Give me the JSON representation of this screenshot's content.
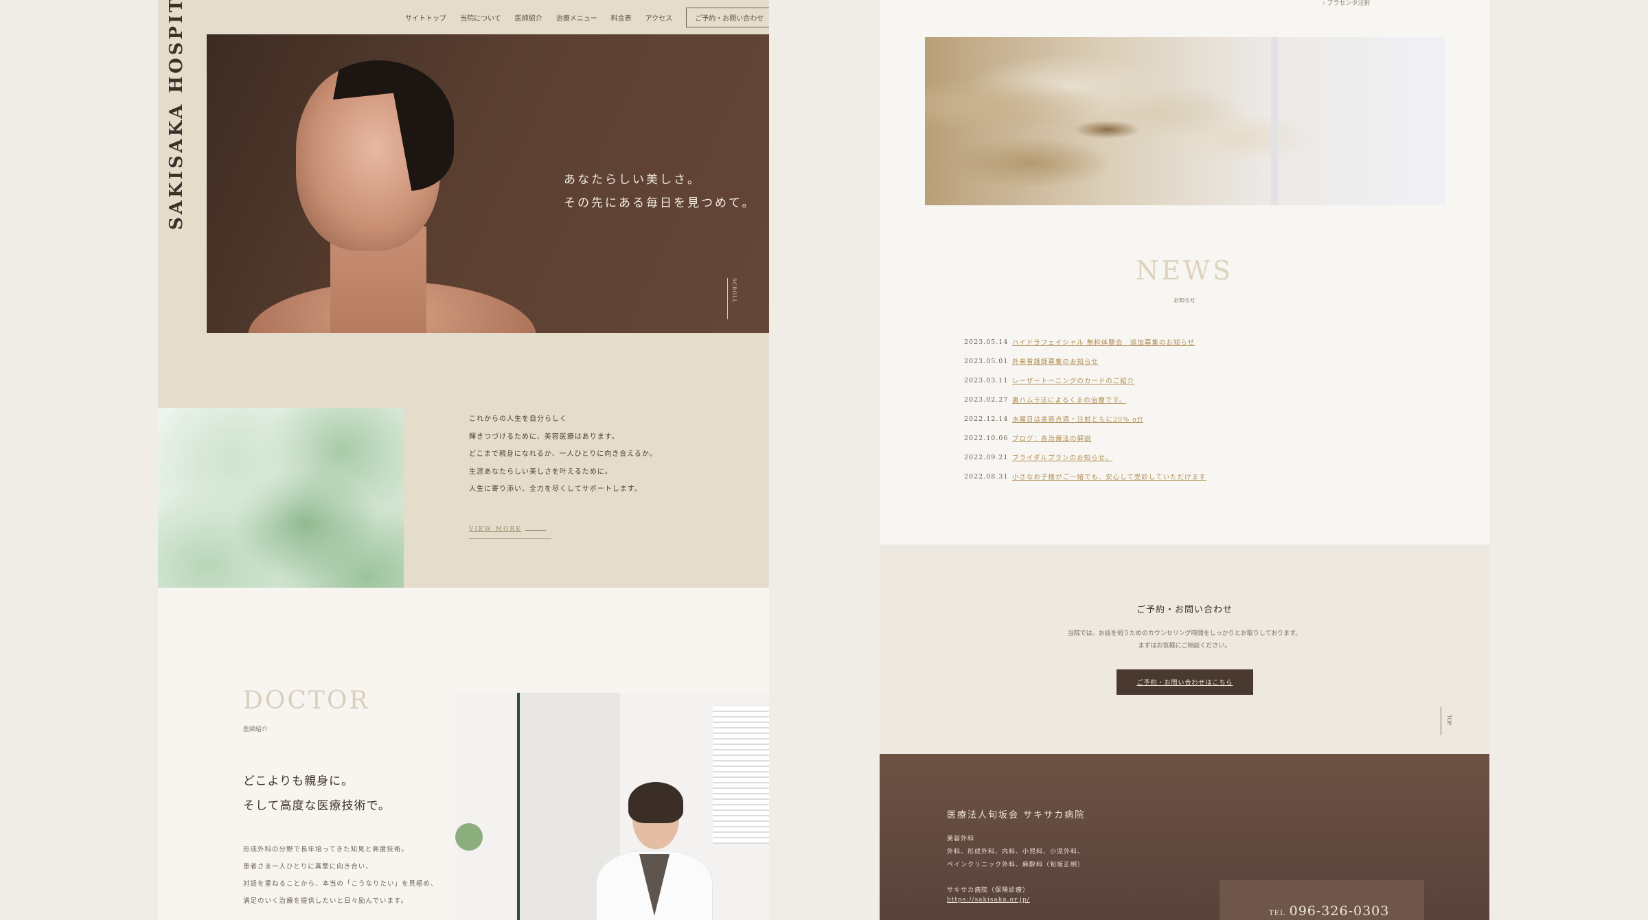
{
  "brand": "SAKISAKA HOSPITAL",
  "nav": {
    "items": [
      "サイトトップ",
      "当院について",
      "医師紹介",
      "治療メニュー",
      "料金表",
      "アクセス"
    ],
    "cta": "ご予約・お問い合わせ"
  },
  "hero": {
    "line1": "あなたらしい美しさ。",
    "line2": "その先にある毎日を見つめて。",
    "scroll": "SCROLL"
  },
  "about": {
    "lines": [
      "これからの人生を自分らしく",
      "輝きつづけるために、美容医療はあります。",
      "どこまで親身になれるか、一人ひとりに向き合えるか。",
      "生涯あなたらしい美しさを叶えるために。",
      "人生に寄り添い、全力を尽くしてサポートします。"
    ],
    "view_more": "VIEW MORE"
  },
  "doctor": {
    "title": "DOCTOR",
    "subtitle": "医師紹介",
    "lead1": "どこよりも親身に。",
    "lead2": "そして高度な医療技術で。",
    "body": [
      "形成外科の分野で長年培ってきた知見と高度技術。",
      "患者さま一人ひとりに真摯に向き合い、",
      "対話を重ねることから、本当の「こうなりたい」を見極め、",
      "満足のいく治療を提供したいと日々励んでいます。"
    ]
  },
  "right_top": {
    "small": "› プラセンタ注射"
  },
  "news": {
    "title": "NEWS",
    "subtitle": "お知らせ",
    "items": [
      {
        "date": "2023.05.14",
        "text": "ハイドラフェイシャル 無料体験会　追加募集のお知らせ"
      },
      {
        "date": "2023.05.01",
        "text": "外来看護師募集のお知らせ"
      },
      {
        "date": "2023.03.11",
        "text": "レーザートーニングのカードのご紹介"
      },
      {
        "date": "2023.02.27",
        "text": "裏ハムラ法によるくまの治療です。"
      },
      {
        "date": "2022.12.14",
        "text": "水曜日は美容点滴・注射ともに20% off"
      },
      {
        "date": "2022.10.06",
        "text": "ブログ：各治療法の解説"
      },
      {
        "date": "2022.09.21",
        "text": "ブライダルプランのお知らせ。"
      },
      {
        "date": "2022.08.31",
        "text": "小さなお子様がご一緒でも、安心して受診していただけます"
      }
    ]
  },
  "contact": {
    "title": "ご予約・お問い合わせ",
    "text1": "当院では、お話を伺うためのカウンセリング時間をしっかりとお取りしております。",
    "text2": "まずはお気軽にご相談ください。",
    "button": "ご予約・お問い合わせはこちら",
    "top": "TOP"
  },
  "footer": {
    "name": "医療法人旬坂会 サキサカ病院",
    "dept": [
      "美容外科",
      "外科、形成外科、内科、小児科、小児外科、",
      "ペインクリニック外科、麻酔科（旬坂正明）"
    ],
    "url_label": "サキサカ病院（保険診療）",
    "url": "https://sakisaka.or.jp/",
    "tel_label": "TEL",
    "tel": "096-326-0303"
  },
  "colors": {
    "beige": "#e5ddcc",
    "hero_brown": "#5a3f31",
    "button_brown": "#4a3930",
    "link_gold": "#b08e53",
    "footer_brown": "#6d5244"
  }
}
